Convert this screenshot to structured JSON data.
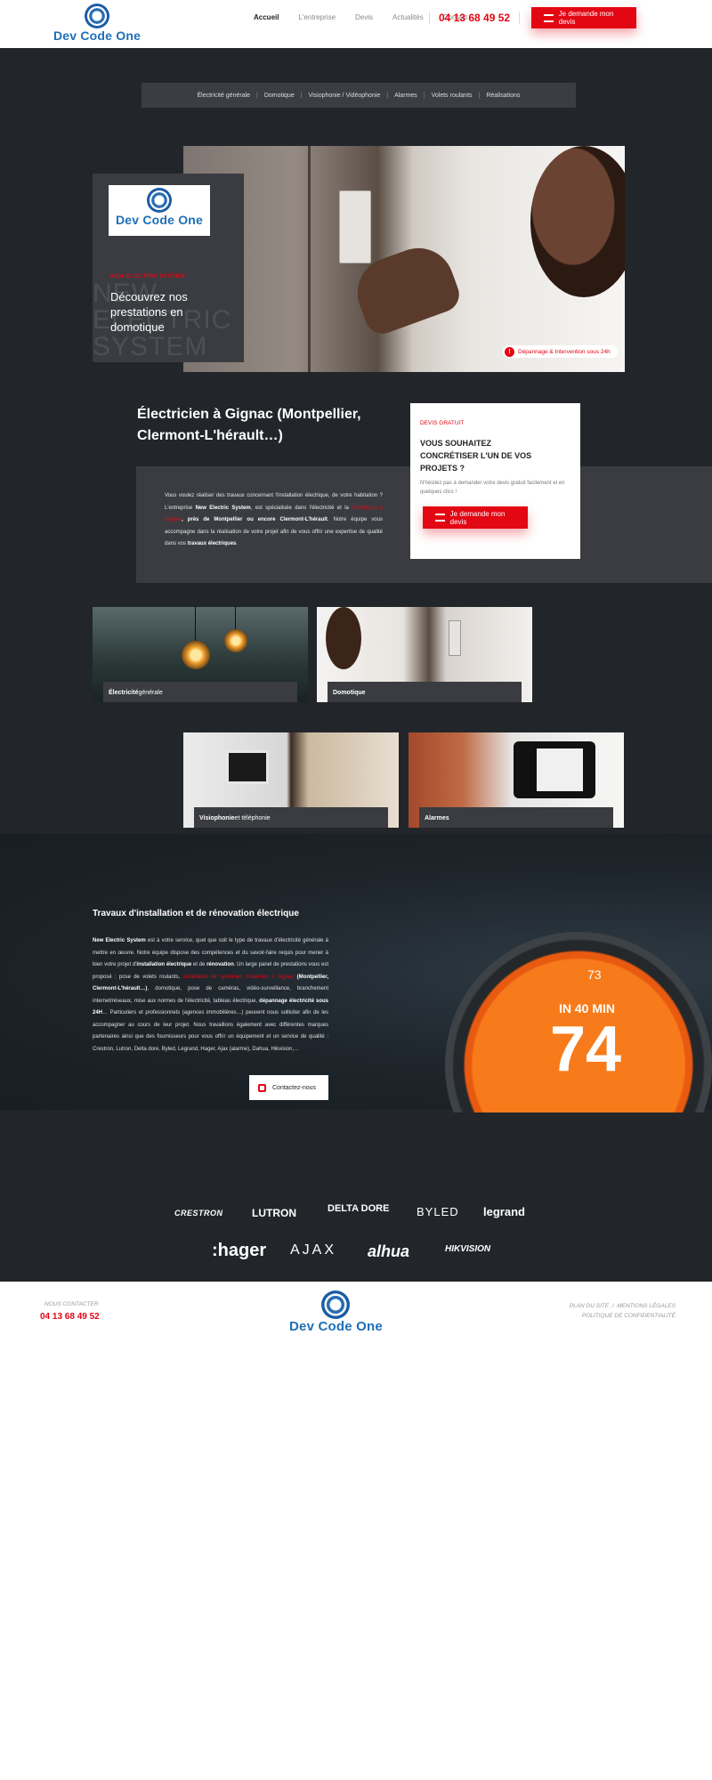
{
  "header": {
    "logo_text": "Dev Code One",
    "nav": [
      "Accueil",
      "L'entreprise",
      "Devis",
      "Actualités",
      "Contact"
    ],
    "phone": "04 13 68 49 52",
    "cta_label": "Je demande mon devis"
  },
  "subnav": [
    "Électricité générale",
    "Domotique",
    "Visiophonie / Vidéophonie",
    "Alarmes",
    "Volets roulants",
    "Réalisations"
  ],
  "hero": {
    "logo_text": "Dev Code One",
    "kicker": "NEW ELECTRIC SYSTEM",
    "ghost_text": "NEW ELECTRIC SYSTEM",
    "title": "Découvrez nos prestations en domotique",
    "badge": "Dépannage & Intervention sous 24h"
  },
  "intro": {
    "title": "Électricien à Gignac (Montpellier, Clermont-L'hérault…)",
    "text_parts": {
      "p1": "Vous voulez réaliser des travaux concernant l'installation électrique, de votre habitation ? L'entreprise ",
      "b1": "New Electric System",
      "p2": ", est spécialisée dans l'électricité et la ",
      "red1": "domotique à Gignac",
      "b2": ", près de Montpellier ou encore Clermont-L'hérault",
      "p3": ". Notre équipe vous accompagne dans la réalisation de votre projet afin de vous offrir une expertise de qualité dans vos ",
      "b3": "travaux électriques",
      "p4": "."
    }
  },
  "devis": {
    "kicker": "DEVIS GRATUIT",
    "title": "VOUS SOUHAITEZ CONCRÉTISER L'UN DE VOS PROJETS ?",
    "text": "N'hésitez pas à demander votre devis gratuit facilement et en quelques clics !",
    "cta_label": "Je demande mon devis"
  },
  "services": [
    {
      "bold": "Électricité",
      "rest": " générale"
    },
    {
      "bold": "Domotique",
      "rest": ""
    },
    {
      "bold": "Visiophonie",
      "rest": " et téléphonie"
    },
    {
      "bold": "Alarmes",
      "rest": ""
    }
  ],
  "renovation": {
    "title": "Travaux d'installation et de rénovation électrique",
    "text_parts": {
      "b1": "New Electric System",
      "p1": " est à votre service, quel que soit le type de travaux d'électricité générale à mettre en œuvre. Notre équipe dispose des compétences et du savoir-faire requis pour mener à bien votre projet d'",
      "b2": "installation électrique",
      "p2": " et de ",
      "b3": "rénovation",
      "p3": ". Un large panel de prestations vous est proposé : pose de volets roulants, ",
      "red1": "installation de systèmes d'alarmes à Gignac",
      "b4": " (Montpellier, Clermont-L'hérault…)",
      "p4": ", domotique, pose de caméras, vidéo-surveillance, branchement internet/réseaux, mise aux normes de l'électricité, tableau électrique, ",
      "b5": "dépannage électricité sous 24H",
      "p5": "… Particuliers et professionnels (agences immobilières…) peuvent nous solliciter afin de les accompagner au cours de leur projet. Nous travaillons également avec différentes marques partenaires ainsi que des fournisseurs pour vous offrir un équipement et un service de qualité : Crestron, Lutron, Delta dore, Byled, Legrand, Hager, Ajax (alarme), Dahua, Hikvision,…"
    },
    "cta_label": "Contactez-nous",
    "dial_small": "73",
    "dial_label": "IN 40 MIN",
    "dial_value": "74"
  },
  "brands": [
    "CRESTRON",
    "LUTRON",
    "DELTA DORE",
    "BYLED",
    "legrand",
    ":hager",
    "AJAX",
    "alhua",
    "HIKVISION"
  ],
  "footer": {
    "contact_label": "NOUS CONTACTER",
    "phone": "04 13 68 49 52",
    "logo_text": "Dev Code One",
    "link1": "PLAN DU SITE",
    "link_sep": "/",
    "link2": "MENTIONS LÉGALES",
    "link3": "POLITIQUE DE CONFIDENTIALITÉ"
  },
  "colors": {
    "accent": "#e30613",
    "dark_bg": "#22262b",
    "card_bg": "#3a3c41",
    "logo_blue": "#1f6fb8"
  }
}
